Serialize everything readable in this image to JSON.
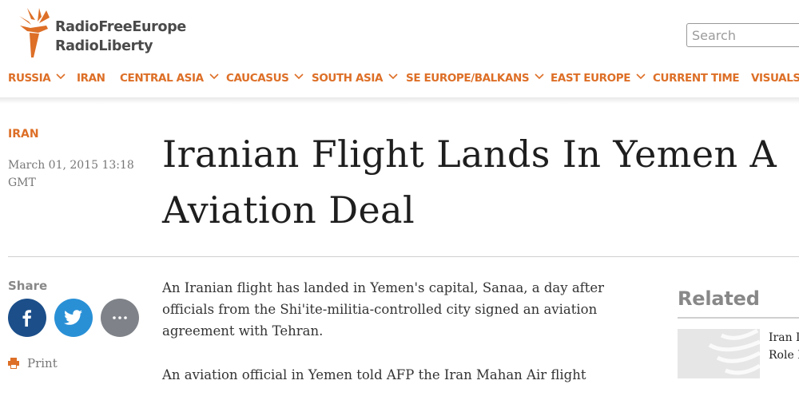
{
  "brand": {
    "line1": "RadioFreeEurope",
    "line2": "RadioLiberty",
    "logo_icon": "torch-icon",
    "accent_color": "#dd6f27"
  },
  "search": {
    "placeholder": "Search"
  },
  "nav": {
    "items": [
      {
        "label": "RUSSIA",
        "chevron": true
      },
      {
        "label": "IRAN",
        "chevron": false
      },
      {
        "label": "CENTRAL ASIA",
        "chevron": true
      },
      {
        "label": "CAUCASUS",
        "chevron": true
      },
      {
        "label": "SOUTH ASIA",
        "chevron": true
      },
      {
        "label": "SE EUROPE/BALKANS",
        "chevron": true
      },
      {
        "label": "EAST EUROPE",
        "chevron": true
      },
      {
        "label": "CURRENT TIME",
        "chevron": false
      },
      {
        "label": "VISUALS",
        "chevron": false
      }
    ]
  },
  "article": {
    "section": "IRAN",
    "date": "March 01, 2015 13:18 GMT",
    "headline_line1": "Iranian Flight Lands In Yemen A",
    "headline_line2": "Aviation Deal",
    "paragraphs": [
      "An Iranian flight has landed in Yemen's capital, Sanaa, a day after officials from the Shi'ite-militia-controlled city signed an aviation agreement with Tehran.",
      "An aviation official in Yemen told AFP the Iran Mahan Air flight"
    ]
  },
  "share": {
    "label": "Share",
    "buttons": [
      {
        "icon": "facebook-icon",
        "color": "#1c4f8a"
      },
      {
        "icon": "twitter-icon",
        "color": "#2990d6"
      },
      {
        "icon": "more-icon",
        "color": "#7f8389"
      }
    ],
    "print_label": "Print"
  },
  "related": {
    "heading": "Related",
    "item_line1": "Iran I",
    "item_line2": "Role I"
  }
}
